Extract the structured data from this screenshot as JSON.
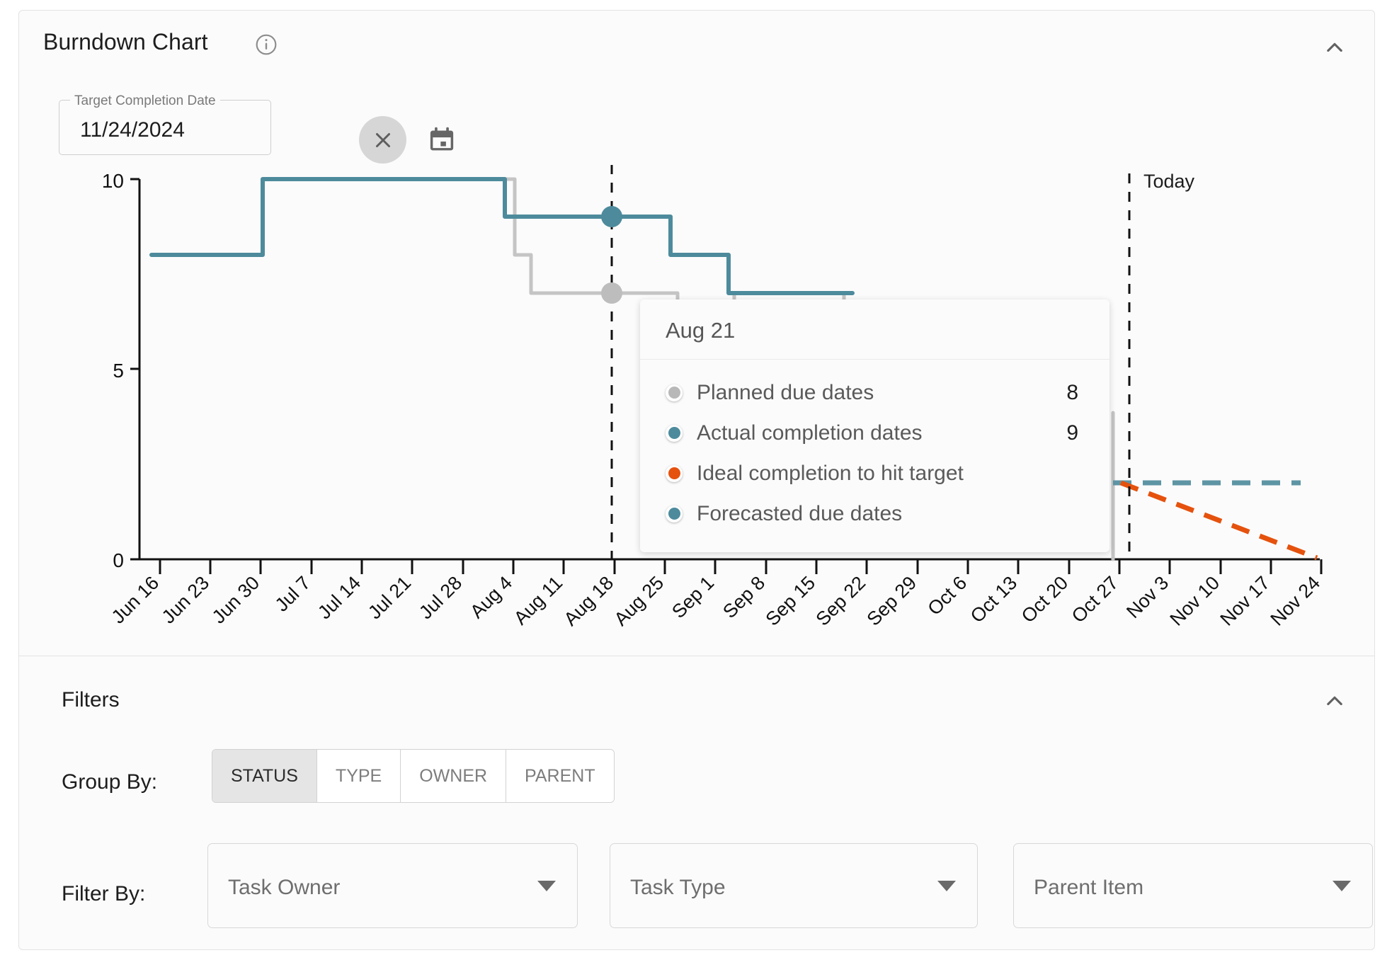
{
  "panel": {
    "title": "Burndown Chart",
    "info_icon": "info-icon",
    "collapse_icon": "chevron-up-icon"
  },
  "date_field": {
    "legend": "Target Completion Date",
    "value": "11/24/2024",
    "clear_icon": "close-icon",
    "calendar_icon": "calendar-icon"
  },
  "tooltip": {
    "date": "Aug 21",
    "rows": [
      {
        "label": "Planned due dates",
        "value": "8",
        "color": "#b8b8b8"
      },
      {
        "label": "Actual completion dates",
        "value": "9",
        "color": "#4d8b9c"
      },
      {
        "label": "Ideal completion to hit target",
        "value": "",
        "color": "#e5520e"
      },
      {
        "label": "Forecasted due dates",
        "value": "",
        "color": "#4d8b9c"
      }
    ]
  },
  "today_marker": {
    "label": "Today",
    "date": "Oct 31"
  },
  "filters": {
    "title": "Filters",
    "collapse_icon": "chevron-up-icon",
    "group_by": {
      "label": "Group By:",
      "options": [
        "STATUS",
        "TYPE",
        "OWNER",
        "PARENT"
      ],
      "selected": "STATUS"
    },
    "filter_by": {
      "label": "Filter By:",
      "selects": [
        {
          "name": "task-owner",
          "placeholder": "Task Owner",
          "value": ""
        },
        {
          "name": "task-type",
          "placeholder": "Task Type",
          "value": ""
        },
        {
          "name": "parent-item",
          "placeholder": "Parent Item",
          "value": ""
        }
      ]
    }
  },
  "chart_data": {
    "type": "line",
    "title": "Burndown Chart",
    "xlabel": "",
    "ylabel": "",
    "ylim": [
      0,
      10
    ],
    "yticks": [
      0,
      5,
      10
    ],
    "grid": false,
    "legend_position": "tooltip",
    "categories": [
      "Jun 16",
      "Jun 23",
      "Jun 30",
      "Jul 7",
      "Jul 14",
      "Jul 21",
      "Jul 28",
      "Aug 4",
      "Aug 11",
      "Aug 18",
      "Aug 25",
      "Sep 1",
      "Sep 8",
      "Sep 15",
      "Sep 22",
      "Sep 29",
      "Oct 6",
      "Oct 13",
      "Oct 20",
      "Oct 27",
      "Nov 3",
      "Nov 10",
      "Nov 17",
      "Nov 24"
    ],
    "annotations": [
      {
        "text": "Today",
        "x": "Oct 31",
        "type": "vertical-dashed-line"
      },
      {
        "text": "Aug 21",
        "x": "Aug 21",
        "type": "hover-cursor-dashed-line"
      }
    ],
    "highlight_point": {
      "x": "Aug 21",
      "planned": 8,
      "actual": 9
    },
    "series": [
      {
        "name": "Planned due dates",
        "color": "#c4c4c4",
        "style": "step-solid",
        "points": [
          {
            "x": "Jun 18",
            "y": 8
          },
          {
            "x": "Jul 2",
            "y": 8
          },
          {
            "x": "Jul 2",
            "y": 10
          },
          {
            "x": "Aug 8",
            "y": 10
          },
          {
            "x": "Aug 8",
            "y": 8
          },
          {
            "x": "Aug 29",
            "y": 8
          },
          {
            "x": "Aug 29",
            "y": 7
          },
          {
            "x": "Sep 20",
            "y": 7
          }
        ]
      },
      {
        "name": "Actual completion dates",
        "color": "#4d8b9c",
        "style": "step-solid",
        "points": [
          {
            "x": "Jun 18",
            "y": 8
          },
          {
            "x": "Jul 2",
            "y": 8
          },
          {
            "x": "Jul 2",
            "y": 10
          },
          {
            "x": "Aug 6",
            "y": 10
          },
          {
            "x": "Aug 6",
            "y": 9
          },
          {
            "x": "Aug 29",
            "y": 9
          },
          {
            "x": "Aug 29",
            "y": 8
          },
          {
            "x": "Sep 7",
            "y": 8
          },
          {
            "x": "Sep 7",
            "y": 7
          },
          {
            "x": "Sep 22",
            "y": 7
          }
        ]
      },
      {
        "name": "Forecasted due dates",
        "color": "#5e95a4",
        "style": "dashed",
        "points": [
          {
            "x": "Oct 27",
            "y": 2
          },
          {
            "x": "Nov 22",
            "y": 2
          }
        ]
      },
      {
        "name": "Ideal completion to hit target",
        "color": "#e5520e",
        "style": "dashed",
        "points": [
          {
            "x": "Oct 31",
            "y": 2
          },
          {
            "x": "Nov 24",
            "y": 0
          }
        ]
      }
    ]
  }
}
